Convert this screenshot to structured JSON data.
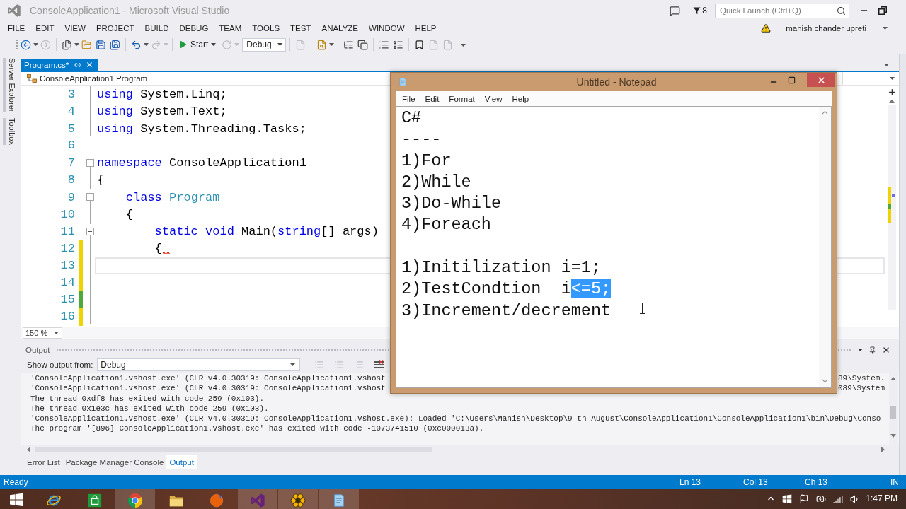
{
  "window": {
    "title": "ConsoleApplication1 - Microsoft Visual Studio",
    "notification_count": "8",
    "quick_launch": {
      "placeholder": "Quick Launch (Ctrl+Q)"
    }
  },
  "menu": {
    "items": [
      "FILE",
      "EDIT",
      "VIEW",
      "PROJECT",
      "BUILD",
      "DEBUG",
      "TEAM",
      "TOOLS",
      "TEST",
      "ANALYZE",
      "WINDOW",
      "HELP"
    ],
    "user": "manish chander upreti"
  },
  "toolbar": {
    "items": [
      {
        "kind": "button",
        "disabled": false,
        "menu": true
      },
      {
        "kind": "button",
        "disabled": true,
        "menu": false
      },
      {
        "kind": "button",
        "disabled": false,
        "menu": true
      },
      {
        "kind": "button",
        "disabled": false,
        "menu": false
      },
      {
        "kind": "button",
        "disabled": false,
        "menu": false
      },
      {
        "kind": "button",
        "disabled": false,
        "menu": false
      },
      {
        "kind": "button",
        "disabled": false,
        "menu": true
      },
      {
        "kind": "button",
        "disabled": true,
        "menu": true
      },
      {
        "kind": "start",
        "label": "Start",
        "menu": true
      },
      {
        "kind": "button",
        "disabled": true,
        "menu": true
      },
      {
        "kind": "dropdown",
        "value": "Debug"
      },
      {
        "kind": "button",
        "disabled": true,
        "menu": false
      },
      {
        "kind": "button",
        "disabled": false,
        "menu": true
      },
      {
        "kind": "button",
        "disabled": false,
        "menu": false
      },
      {
        "kind": "button",
        "disabled": false,
        "menu": false
      },
      {
        "kind": "button",
        "disabled": false,
        "menu": false
      },
      {
        "kind": "button",
        "disabled": false,
        "menu": false
      },
      {
        "kind": "button",
        "disabled": false,
        "menu": false
      },
      {
        "kind": "button",
        "disabled": true,
        "menu": false
      },
      {
        "kind": "button",
        "disabled": true,
        "menu": false
      }
    ]
  },
  "side_tabs": [
    "Server Explorer",
    "Toolbox"
  ],
  "document_tabs": [
    {
      "label": "Program.cs*",
      "selected": true
    }
  ],
  "editor": {
    "navigation": "ConsoleApplication1.Program",
    "zoom": "150 %",
    "lines": [
      {
        "number": "3",
        "tokens": [
          {
            "kind": "keyword",
            "text": "using"
          },
          {
            "kind": "plain",
            "text": " System.Linq;"
          }
        ],
        "fold": false,
        "guide": true,
        "guide_end": false,
        "current": false,
        "error": false
      },
      {
        "number": "4",
        "tokens": [
          {
            "kind": "keyword",
            "text": "using"
          },
          {
            "kind": "plain",
            "text": " System.Text;"
          }
        ],
        "fold": false,
        "guide": true,
        "guide_end": false,
        "current": false,
        "error": false
      },
      {
        "number": "5",
        "tokens": [
          {
            "kind": "keyword",
            "text": "using"
          },
          {
            "kind": "plain",
            "text": " System.Threading.Tasks;"
          }
        ],
        "fold": false,
        "guide": false,
        "guide_end": true,
        "current": false,
        "error": false
      },
      {
        "number": "6",
        "fold": false,
        "guide": false,
        "guide_end": false,
        "current": false,
        "error": false
      },
      {
        "number": "7",
        "tokens": [
          {
            "kind": "keyword",
            "text": "namespace"
          },
          {
            "kind": "plain",
            "text": " ConsoleApplication1"
          }
        ],
        "fold": true,
        "guide": true,
        "guide_end": false,
        "current": false,
        "error": false
      },
      {
        "number": "8",
        "tokens": [
          {
            "kind": "plain",
            "text": "{"
          }
        ],
        "fold": false,
        "guide": true,
        "guide_end": false,
        "current": false,
        "error": false
      },
      {
        "number": "9",
        "tokens": [
          {
            "kind": "keyword",
            "text": "    class "
          },
          {
            "kind": "type",
            "text": "Program"
          }
        ],
        "fold": true,
        "guide": true,
        "guide_end": false,
        "current": false,
        "error": false
      },
      {
        "number": "10",
        "tokens": [
          {
            "kind": "plain",
            "text": "    {"
          }
        ],
        "fold": false,
        "guide": true,
        "guide_end": false,
        "current": false,
        "error": false
      },
      {
        "number": "11",
        "tokens": [
          {
            "kind": "keyword",
            "text": "        static void"
          },
          {
            "kind": "plain",
            "text": " Main("
          },
          {
            "kind": "keyword",
            "text": "string"
          },
          {
            "kind": "plain",
            "text": "[] args)"
          }
        ],
        "fold": true,
        "guide": true,
        "guide_end": false,
        "current": false,
        "error": false
      },
      {
        "number": "12",
        "tokens": [
          {
            "kind": "plain",
            "text": "        {"
          }
        ],
        "color": "#efd300",
        "fold": false,
        "guide": true,
        "guide_end": false,
        "current": false,
        "error": true
      },
      {
        "number": "13",
        "color": "#efd300",
        "fold": false,
        "guide": true,
        "guide_end": false,
        "current": true,
        "error": false
      },
      {
        "number": "14",
        "color": "#efd300",
        "fold": false,
        "guide": true,
        "guide_end": false,
        "current": false,
        "error": false
      },
      {
        "number": "15",
        "color": "#4caa3c",
        "fold": false,
        "guide": true,
        "guide_end": false,
        "current": false,
        "error": false
      },
      {
        "number": "16",
        "color": "#efd300",
        "fold": false,
        "guide": false,
        "guide_end": true,
        "current": false,
        "error": false
      }
    ]
  },
  "output": {
    "title": "Output",
    "source_label": "Show output from:",
    "source": "Debug",
    "tools": [
      {
        "disabled": true
      },
      {
        "disabled": true
      },
      {
        "disabled": true
      },
      {
        "disabled": false
      }
    ],
    "lines": [
      {
        "parts": [
          "'ConsoleApplication1.vshost.exe' (CLR v4.0.30319: ConsoleApplication1.vshost",
          "89\\System."
        ]
      },
      {
        "parts": [
          "'ConsoleApplication1.vshost.exe' (CLR v4.0.30319: ConsoleApplication1.vshost",
          "089\\System"
        ]
      },
      {
        "parts": [
          "The thread 0xdf8 has exited with code 259 (0x103)."
        ]
      },
      {
        "parts": [
          "The thread 0x1e3c has exited with code 259 (0x103)."
        ]
      },
      {
        "parts": [
          "'ConsoleApplication1.vshost.exe' (CLR v4.0.30319: ConsoleApplication1.vshost.exe): Loaded 'C:\\Users\\Manish\\Desktop\\9 th August\\ConsoleApplication1\\ConsoleApplication1\\bin\\Debug\\Conso"
        ]
      },
      {
        "parts": [
          "The program '[896] ConsoleApplication1.vshost.exe' has exited with code -1073741510 (0xc000013a)."
        ]
      }
    ],
    "tabs": [
      {
        "label": "Error List",
        "selected": false
      },
      {
        "label": "Package Manager Console",
        "selected": false
      },
      {
        "label": "Output",
        "selected": true
      }
    ]
  },
  "status_bar": {
    "message": "Ready",
    "line": "Ln 13",
    "column": "Col 13",
    "character": "Ch 13",
    "mode": "IN"
  },
  "notepad": {
    "title": "Untitled - Notepad",
    "menu": [
      "File",
      "Edit",
      "Format",
      "View",
      "Help"
    ],
    "blocks": [
      {
        "lines": [
          {
            "segments": [
              {
                "text": "C#",
                "selected": false
              }
            ]
          },
          {
            "segments": [
              {
                "text": "----",
                "selected": false
              }
            ]
          },
          {
            "segments": [
              {
                "text": "1)For",
                "selected": false
              }
            ]
          },
          {
            "segments": [
              {
                "text": "2)While",
                "selected": false
              }
            ]
          },
          {
            "segments": [
              {
                "text": "3)Do-While",
                "selected": false
              }
            ]
          },
          {
            "segments": [
              {
                "text": "4)Foreach",
                "selected": false
              }
            ]
          }
        ]
      },
      {
        "lines": [
          {
            "segments": [
              {
                "text": "1)Initilization i=1;",
                "selected": false
              }
            ]
          },
          {
            "segments": [
              {
                "text": "2)TestCondtion  i",
                "selected": false
              },
              {
                "text": "<=5;",
                "selected": true
              }
            ]
          },
          {
            "segments": [
              {
                "text": "3)Increment/decrement",
                "selected": false
              }
            ]
          }
        ]
      }
    ]
  },
  "taskbar": {
    "buttons": [
      {
        "running": false
      },
      {
        "running": false
      },
      {
        "running": false
      },
      {
        "running": true
      },
      {
        "running": false
      },
      {
        "running": false
      },
      {
        "running": true
      },
      {
        "running": true
      },
      {
        "running": true
      }
    ],
    "clock": "1:47 PM"
  }
}
